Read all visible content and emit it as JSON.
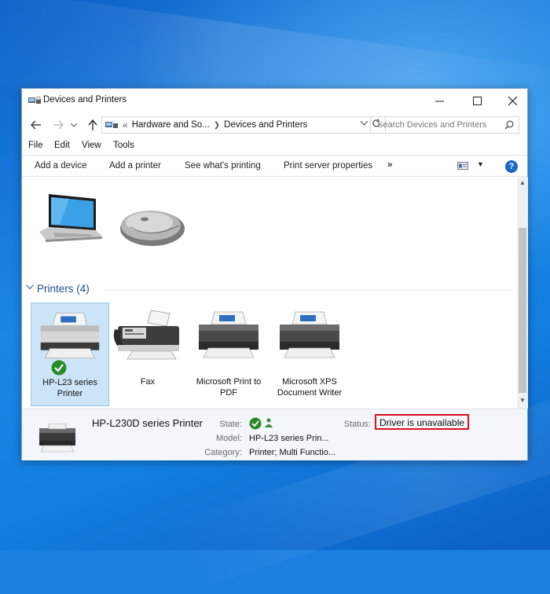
{
  "window": {
    "title": "Devices and Printers"
  },
  "address": {
    "overflow": "«",
    "crumbs": [
      "Hardware and So...",
      "Devices and Printers"
    ]
  },
  "search": {
    "placeholder": "Search Devices and Printers"
  },
  "menu": [
    "File",
    "Edit",
    "View",
    "Tools"
  ],
  "commands": [
    "Add a device",
    "Add a printer",
    "See what's printing",
    "Print server properties"
  ],
  "command_more": "»",
  "groups": {
    "printers_header": "Printers (4)"
  },
  "printers": [
    {
      "name": "HP-L23 series Printer",
      "selected": true,
      "default": true
    },
    {
      "name": "Fax"
    },
    {
      "name": "Microsoft Print to PDF"
    },
    {
      "name": "Microsoft XPS Document Writer"
    }
  ],
  "details": {
    "device_name": "HP-L230D series Printer",
    "state_label": "State:",
    "model_label": "Model:",
    "model_value": "HP-L23 series Prin...",
    "category_label": "Category:",
    "category_value": "Printer; Multi Functio...",
    "status_label": "Status:",
    "status_value": "Driver is unavailable"
  },
  "colors": {
    "highlight_border": "#e0101a",
    "selection_bg": "#cce4f7",
    "group_header": "#1e4e8c",
    "check_green": "#2a8a2a"
  },
  "icons": [
    "app-devices-icon",
    "back-arrow-icon",
    "forward-arrow-icon",
    "up-arrow-icon",
    "refresh-icon",
    "search-icon",
    "help-icon",
    "laptop-icon",
    "mouse-icon",
    "printer-icon",
    "fax-icon",
    "default-check-icon"
  ]
}
